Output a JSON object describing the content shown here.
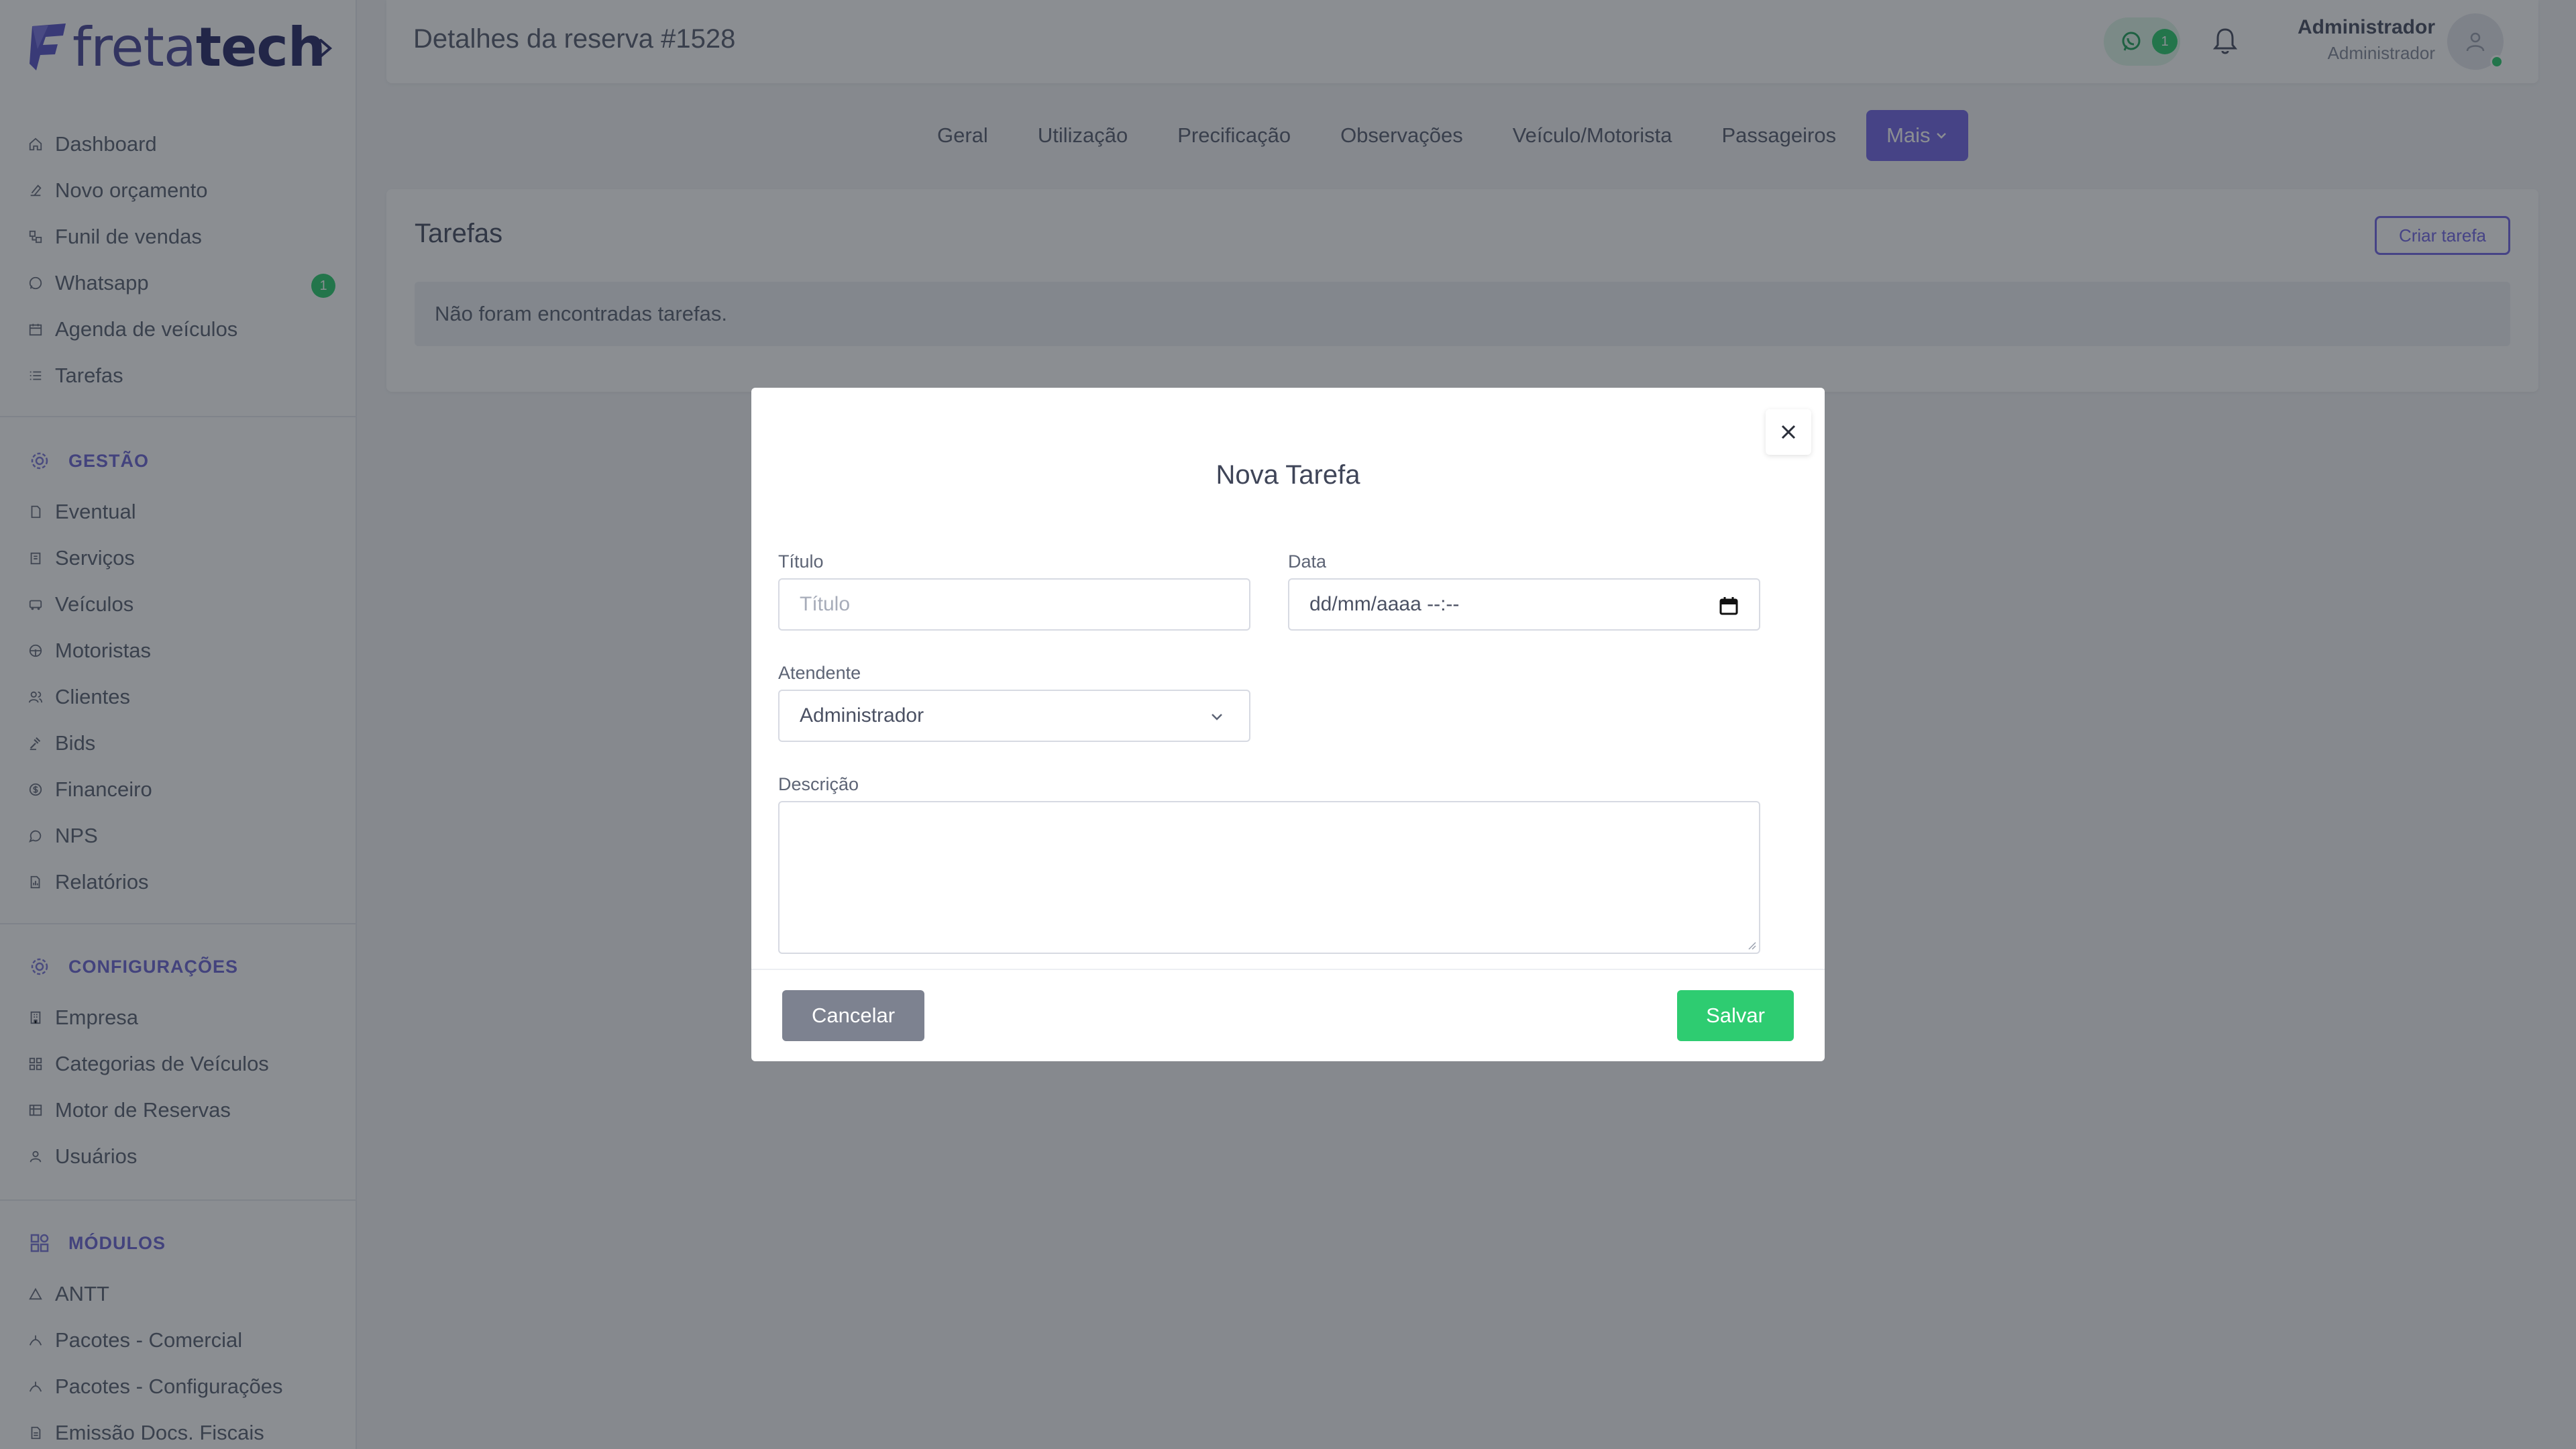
{
  "brand": {
    "logo_text_light": "freta",
    "logo_text_bold": "tech",
    "brand_color": "#4c4a9a"
  },
  "sidebar": {
    "main_items": [
      {
        "label": "Dashboard",
        "icon": "home-icon"
      },
      {
        "label": "Novo orçamento",
        "icon": "edit-icon"
      },
      {
        "label": "Funil de vendas",
        "icon": "funnel-icon"
      },
      {
        "label": "Whatsapp",
        "icon": "whatsapp-icon",
        "badge": "1"
      },
      {
        "label": "Agenda de veículos",
        "icon": "calendar-icon"
      },
      {
        "label": "Tarefas",
        "icon": "list-icon"
      }
    ],
    "section_gestao": "GESTÃO",
    "gestao_items": [
      {
        "label": "Eventual",
        "icon": "file-icon"
      },
      {
        "label": "Serviços",
        "icon": "clipboard-icon"
      },
      {
        "label": "Veículos",
        "icon": "bus-icon"
      },
      {
        "label": "Motoristas",
        "icon": "steering-wheel-icon"
      },
      {
        "label": "Clientes",
        "icon": "users-icon"
      },
      {
        "label": "Bids",
        "icon": "gavel-icon"
      },
      {
        "label": "Financeiro",
        "icon": "dollar-icon"
      },
      {
        "label": "NPS",
        "icon": "chat-icon"
      },
      {
        "label": "Relatórios",
        "icon": "report-icon"
      }
    ],
    "section_config": "CONFIGURAÇÕES",
    "config_items": [
      {
        "label": "Empresa",
        "icon": "building-icon"
      },
      {
        "label": "Categorias de Veículos",
        "icon": "grid-icon"
      },
      {
        "label": "Motor de Reservas",
        "icon": "table-icon"
      },
      {
        "label": "Usuários",
        "icon": "user-icon"
      }
    ],
    "section_modulos": "MÓDULOS",
    "modulos_items": [
      {
        "label": "ANTT",
        "icon": "triangle-icon"
      },
      {
        "label": "Pacotes - Comercial",
        "icon": "package-icon"
      },
      {
        "label": "Pacotes - Configurações",
        "icon": "package-icon"
      },
      {
        "label": "Emissão Docs. Fiscais",
        "icon": "document-icon"
      }
    ]
  },
  "header": {
    "title": "Detalhes da reserva #1528",
    "whatsapp_badge": "1",
    "user_name": "Administrador",
    "user_role": "Administrador"
  },
  "tabs": [
    "Geral",
    "Utilização",
    "Precificação",
    "Observações",
    "Veículo/Motorista",
    "Passageiros",
    "Mais"
  ],
  "card": {
    "title": "Tarefas",
    "create_button": "Criar tarefa",
    "empty_message": "Não foram encontradas tarefas."
  },
  "modal": {
    "title": "Nova Tarefa",
    "titulo_label": "Título",
    "titulo_placeholder": "Título",
    "data_label": "Data",
    "data_placeholder": "dd/mm/aaaa --:--",
    "atendente_label": "Atendente",
    "atendente_value": "Administrador",
    "descricao_label": "Descrição",
    "cancel_button": "Cancelar",
    "save_button": "Salvar"
  },
  "colors": {
    "accent": "#7468e6",
    "success": "#2ecc71",
    "cancel": "#7d8290"
  }
}
